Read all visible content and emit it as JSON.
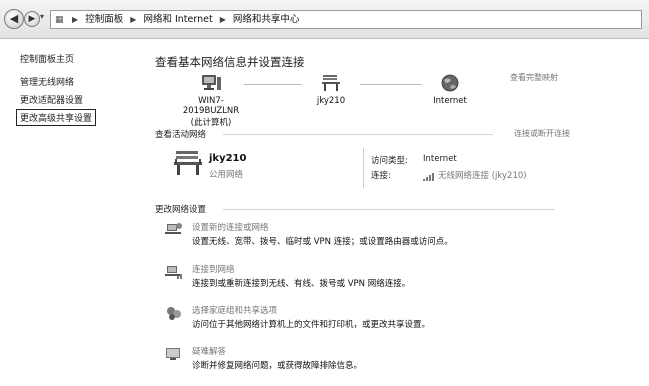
{
  "addressbar": {
    "crumbs": [
      "控制面板",
      "网络和 Internet",
      "网络和共享中心"
    ]
  },
  "sidebar": {
    "home": "控制面板主页",
    "links": [
      "管理无线网络",
      "更改适配器设置",
      "更改高级共享设置"
    ]
  },
  "main": {
    "title": "查看基本网络信息并设置连接",
    "full_map": "查看完整映射",
    "map": {
      "computer_name": "WIN7-2019BUZLNR",
      "computer_note": "(此计算机)",
      "network": "jky210",
      "internet": "Internet"
    },
    "active_header": "查看活动网络",
    "connect_disconnect": "连接或断开连接",
    "active": {
      "name": "jky210",
      "type": "公用网络",
      "access_label": "访问类型:",
      "access_value": "Internet",
      "conn_label": "连接:",
      "conn_value": "无线网络连接 (jky210)"
    },
    "change_header": "更改网络设置",
    "tasks": [
      {
        "title": "设置新的连接或网络",
        "desc": "设置无线、宽带、拨号、临时或 VPN 连接；或设置路由器或访问点。"
      },
      {
        "title": "连接到网络",
        "desc": "连接到或重新连接到无线、有线、拨号或 VPN 网络连接。"
      },
      {
        "title": "选择家庭组和共享选项",
        "desc": "访问位于其他网络计算机上的文件和打印机，或更改共享设置。"
      },
      {
        "title": "疑难解答",
        "desc": "诊断并修复网络问题，或获得故障排除信息。"
      }
    ]
  }
}
